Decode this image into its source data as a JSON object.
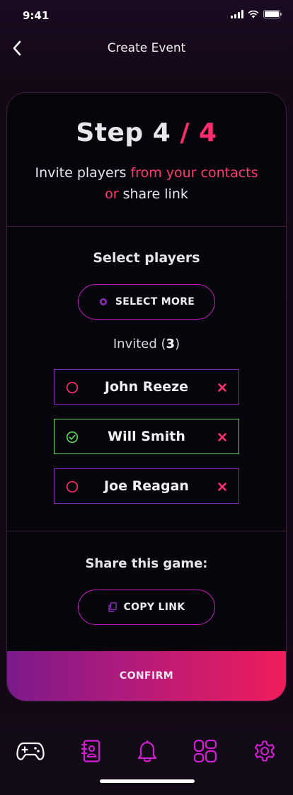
{
  "status_bar": {
    "time": "9:41"
  },
  "header": {
    "title": "Create Event"
  },
  "step": {
    "current": "4",
    "separator": "/",
    "total": "4"
  },
  "subtitle": {
    "part1": "Invite players ",
    "part2": "from your contacts",
    "part3": "or",
    "part4": " share link"
  },
  "select_section": {
    "title": "Select players",
    "button_label": "SELECT MORE"
  },
  "invited": {
    "label": "Invited (",
    "count": "3",
    "suffix": ")"
  },
  "players": [
    {
      "name": "John Reeze",
      "selected": false
    },
    {
      "name": "Will Smith",
      "selected": true
    },
    {
      "name": "Joe Reagan",
      "selected": false
    }
  ],
  "share_section": {
    "title": "Share this game:",
    "button_label": "COPY LINK"
  },
  "confirm_label": "CONFIRM",
  "tabs": [
    "gamepad-icon",
    "contacts-icon",
    "bell-icon",
    "dashboard-icon",
    "settings-icon"
  ],
  "colors": {
    "accent": "#ff2d6e",
    "magenta": "#d21ed2",
    "purple_border": "#8a21b4",
    "success": "#5fd85a"
  }
}
